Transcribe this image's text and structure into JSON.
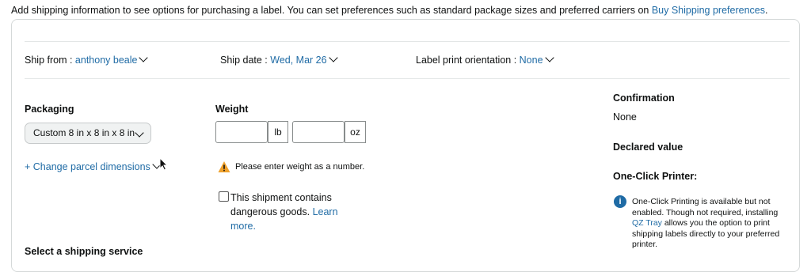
{
  "header": {
    "info_text": "Add shipping information to see options for purchasing a label. You can set preferences such as standard package sizes and preferred carriers on ",
    "info_link": "Buy Shipping preferences",
    "info_suffix": "."
  },
  "ship_row": {
    "ship_from_label": "Ship from :",
    "ship_from_value": "anthony beale",
    "ship_date_label": "Ship date :",
    "ship_date_value": "Wed, Mar 26",
    "orientation_label": "Label print orientation :",
    "orientation_value": "None"
  },
  "packaging": {
    "label": "Packaging",
    "selected": "Custom 8 in x 8 in x 8 in",
    "change_link": "+ Change parcel dimensions"
  },
  "weight": {
    "label": "Weight",
    "lb_value": "",
    "lb_unit": "lb",
    "oz_value": "",
    "oz_unit": "oz",
    "warning": "Please enter weight as a number."
  },
  "dangerous": {
    "line1": "This shipment contains",
    "line2": "dangerous goods.",
    "link_part1": "Learn",
    "link_part2": "more."
  },
  "right_panel": {
    "confirmation_label": "Confirmation",
    "confirmation_value": "None",
    "declared_value_label": "Declared value",
    "one_click_label": "One-Click Printer:",
    "info_line1": "One-Click Printing is available but not",
    "info_line2": "enabled. Though not required, installing",
    "info_link": "QZ Tray",
    "info_line3_rest": " allows you the option to print",
    "info_line4": "shipping labels directly to your preferred",
    "info_line5": "printer."
  },
  "shipping_service": {
    "label": "Select a shipping service"
  },
  "colors": {
    "link": "#1f6ba5",
    "warning": "#f0a12b",
    "info": "#1f6ba5"
  },
  "icons": [
    "chevron-down-icon",
    "warning-icon",
    "info-icon",
    "mouse-cursor-icon"
  ]
}
